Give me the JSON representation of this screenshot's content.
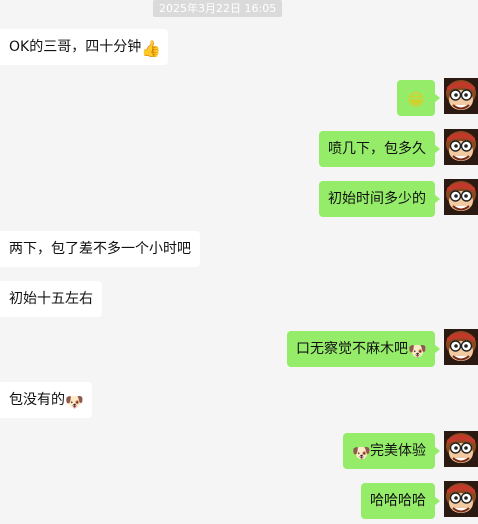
{
  "chat": {
    "timestamp": "2025年3月22日 16:05",
    "messages": [
      {
        "side": "left",
        "text": "OK的三哥，四十分钟",
        "emoji": "👍",
        "emoji_name": "thumbs-up-icon",
        "emoji_pos": "after"
      },
      {
        "side": "right",
        "text": "",
        "emoji": "😁",
        "emoji_name": "grin-emoji-icon",
        "emoji_pos": "after"
      },
      {
        "side": "right",
        "text": "喷几下，包多久",
        "emoji": "",
        "emoji_name": "",
        "emoji_pos": "none"
      },
      {
        "side": "right",
        "text": "初始时间多少的",
        "emoji": "",
        "emoji_name": "",
        "emoji_pos": "none"
      },
      {
        "side": "left",
        "text": "两下，包了差不多一个小时吧",
        "emoji": "",
        "emoji_name": "",
        "emoji_pos": "none"
      },
      {
        "side": "left",
        "text": "初始十五左右",
        "emoji": "",
        "emoji_name": "",
        "emoji_pos": "none"
      },
      {
        "side": "right",
        "text": "口无察觉不麻木吧",
        "emoji": "🐶",
        "emoji_name": "doge-emoji-icon",
        "emoji_pos": "after"
      },
      {
        "side": "left",
        "text": "包没有的",
        "emoji": "🐶",
        "emoji_name": "doge-emoji-icon",
        "emoji_pos": "after"
      },
      {
        "side": "right",
        "text": "完美体验",
        "emoji": "🐶",
        "emoji_name": "doge-emoji-icon",
        "emoji_pos": "before"
      },
      {
        "side": "right",
        "text": "哈哈哈哈",
        "emoji": "",
        "emoji_name": "",
        "emoji_pos": "none"
      }
    ]
  },
  "colors": {
    "background": "#f5f5f5",
    "bubble_left": "#ffffff",
    "bubble_right": "#95ec69",
    "timestamp_bg": "#dadada"
  }
}
